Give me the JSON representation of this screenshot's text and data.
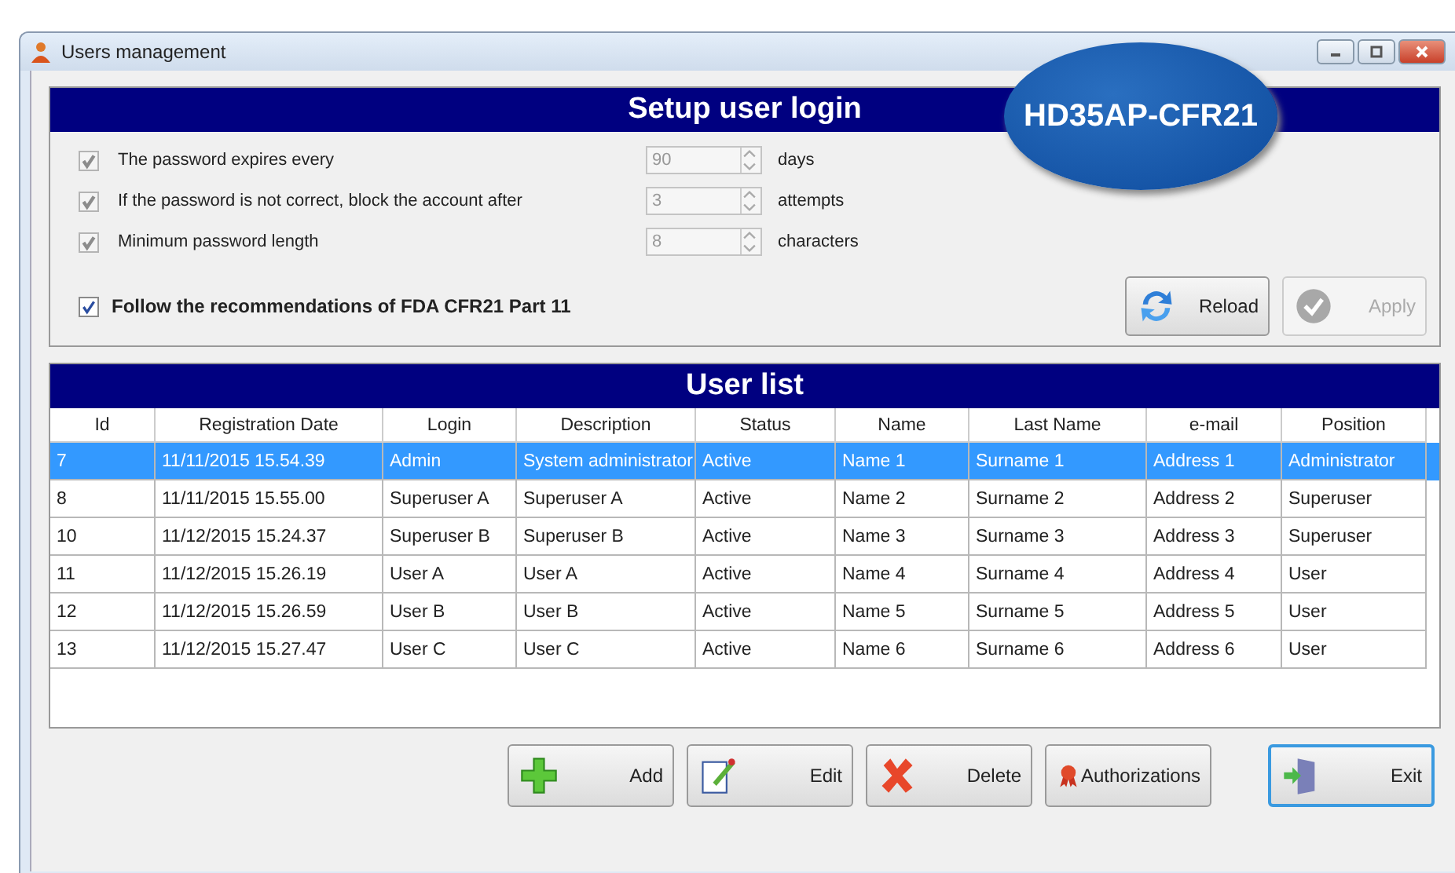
{
  "window": {
    "title": "Users management"
  },
  "badge": "HD35AP-CFR21",
  "setup": {
    "title": "Setup user login",
    "settings": [
      {
        "label": "The password expires every",
        "checked": true,
        "disabled": true,
        "value": "90",
        "unit": "days"
      },
      {
        "label": "If the password is not correct, block the account after",
        "checked": true,
        "disabled": true,
        "value": "3",
        "unit": "attempts"
      },
      {
        "label": "Minimum password length",
        "checked": true,
        "disabled": true,
        "value": "8",
        "unit": "characters"
      }
    ],
    "follow": {
      "label": "Follow the recommendations of FDA CFR21 Part 11",
      "checked": true
    },
    "buttons": [
      {
        "label": "Reload",
        "kind": "reload",
        "disabled": false
      },
      {
        "label": "Apply",
        "kind": "apply",
        "disabled": true
      }
    ]
  },
  "user_list": {
    "title": "User list",
    "columns": [
      "Id",
      "Registration Date",
      "Login",
      "Description",
      "Status",
      "Name",
      "Last Name",
      "e-mail",
      "Position"
    ],
    "rows": [
      {
        "selected": true,
        "cells": [
          "7",
          "11/11/2015 15.54.39",
          "Admin",
          "System administrator",
          "Active",
          "Name 1",
          "Surname 1",
          "Address 1",
          "Administrator"
        ]
      },
      {
        "selected": false,
        "cells": [
          "8",
          "11/11/2015 15.55.00",
          "Superuser A",
          "Superuser A",
          "Active",
          "Name 2",
          "Surname 2",
          "Address 2",
          "Superuser"
        ]
      },
      {
        "selected": false,
        "cells": [
          "10",
          "11/12/2015 15.24.37",
          "Superuser B",
          "Superuser B",
          "Active",
          "Name 3",
          "Surname 3",
          "Address 3",
          "Superuser"
        ]
      },
      {
        "selected": false,
        "cells": [
          "11",
          "11/12/2015 15.26.19",
          "User A",
          "User A",
          "Active",
          "Name 4",
          "Surname 4",
          "Address 4",
          "User"
        ]
      },
      {
        "selected": false,
        "cells": [
          "12",
          "11/12/2015 15.26.59",
          "User B",
          "User B",
          "Active",
          "Name 5",
          "Surname 5",
          "Address 5",
          "User"
        ]
      },
      {
        "selected": false,
        "cells": [
          "13",
          "11/12/2015 15.27.47",
          "User C",
          "User C",
          "Active",
          "Name 6",
          "Surname 6",
          "Address 6",
          "User"
        ]
      }
    ]
  },
  "buttons": [
    {
      "label": "Add",
      "kind": "add",
      "focused": false
    },
    {
      "label": "Edit",
      "kind": "edit",
      "focused": false
    },
    {
      "label": "Delete",
      "kind": "delete",
      "focused": false
    },
    {
      "label": "Authorizations",
      "kind": "auth",
      "focused": false
    },
    {
      "label": "Exit",
      "kind": "exit",
      "focused": true
    }
  ]
}
